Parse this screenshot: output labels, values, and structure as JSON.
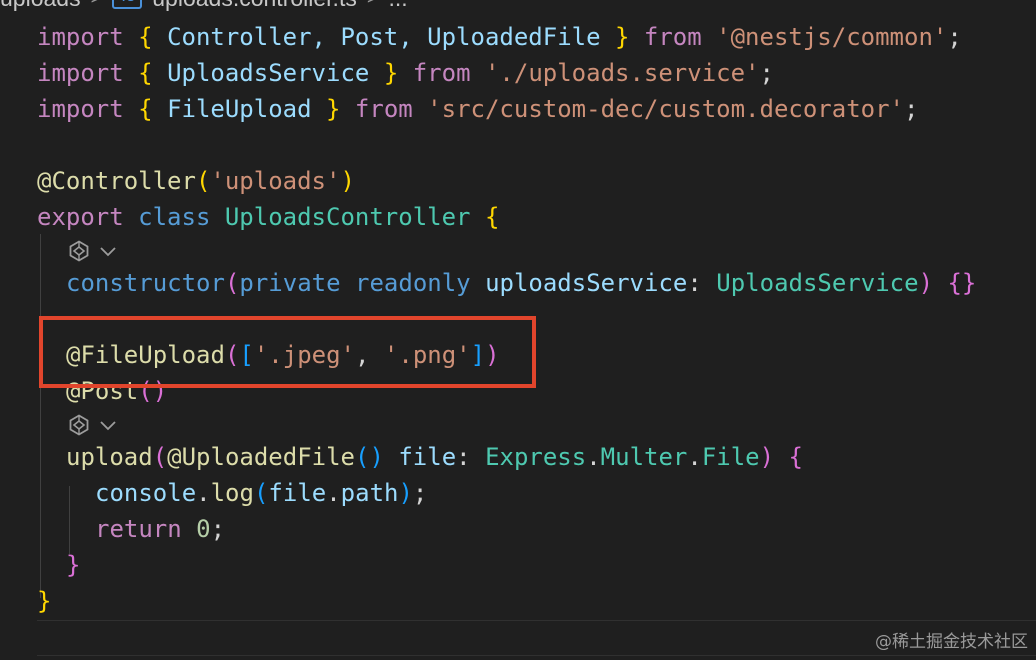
{
  "breadcrumb": {
    "folder": "uploads",
    "sep": ">",
    "file_badge": "TS",
    "file": "uploads.controller.ts",
    "ellipsis": "..."
  },
  "code": {
    "import_kw": "import",
    "from_kw": "from",
    "line1_names": "Controller, Post, UploadedFile",
    "line1_module": "'@nestjs/common'",
    "line2_names": "UploadsService",
    "line2_module": "'./uploads.service'",
    "line3_names": "FileUpload",
    "line3_module": "'src/custom-dec/custom.decorator'",
    "controller_decorator": "@Controller",
    "controller_arg": "'uploads'",
    "export_kw": "export",
    "class_kw": "class",
    "class_name": "UploadsController",
    "constructor_kw": "constructor",
    "private_kw": "private",
    "readonly_kw": "readonly",
    "ctor_param": "uploadsService",
    "ctor_type": "UploadsService",
    "empty_braces": "{}",
    "file_upload_decorator": "@FileUpload",
    "file_upload_arg1": "'.jpeg'",
    "file_upload_arg2": "'.png'",
    "post_decorator": "@Post",
    "upload_method": "upload",
    "uploaded_file_decorator": "@UploadedFile",
    "file_param": "file",
    "express_type": "Express",
    "multer_type": "Multer",
    "file_type": "File",
    "console_obj": "console",
    "log_fn": "log",
    "file_obj": "file",
    "path_prop": "path",
    "return_kw": "return",
    "zero": "0"
  },
  "watermark": "@稀土掘金技术社区",
  "colors": {
    "background": "#1f1f1f",
    "highlight_border": "#e1452c",
    "keyword": "#c586c0",
    "keyword_blue": "#569cd6",
    "identifier": "#9cdcfe",
    "type": "#4ec9b0",
    "function": "#dcdcaa",
    "string": "#ce9178"
  },
  "icons": {
    "codelens": "copilot-icon",
    "chevron": "chevron-down-icon"
  }
}
